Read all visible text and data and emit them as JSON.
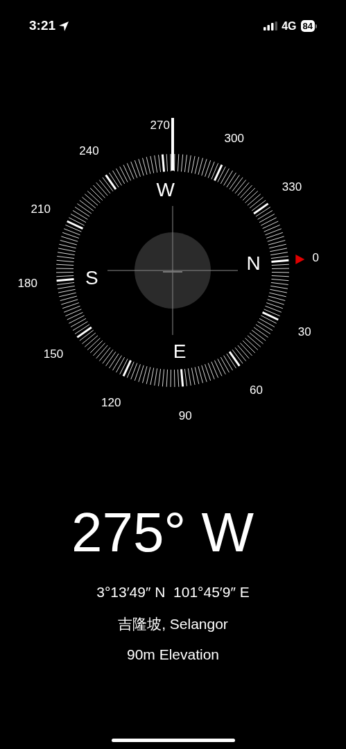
{
  "status_bar": {
    "time": "3:21",
    "network": "4G",
    "battery": "84"
  },
  "compass": {
    "degree_labels": [
      "0",
      "30",
      "60",
      "90",
      "120",
      "150",
      "180",
      "210",
      "240",
      "270",
      "300",
      "330"
    ],
    "cardinals": [
      "N",
      "E",
      "S",
      "W"
    ]
  },
  "readout": {
    "heading": "275° W",
    "coordinates": "3°13′49″ N  101°45′9″ E",
    "place": "吉隆坡, Selangor",
    "elevation": "90m Elevation"
  }
}
